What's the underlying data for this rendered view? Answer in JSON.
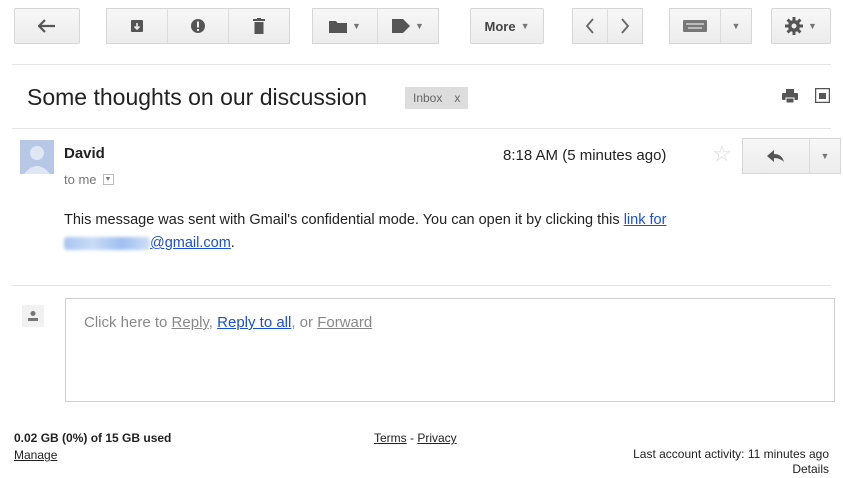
{
  "toolbar": {
    "more_label": "More",
    "icons": [
      "back-arrow-icon",
      "archive-icon",
      "spam-icon",
      "delete-icon",
      "folder-icon",
      "label-icon",
      "prev-icon",
      "next-icon",
      "keyboard-icon",
      "gear-icon"
    ]
  },
  "email": {
    "subject": "Some thoughts on our discussion",
    "label_chip": "Inbox",
    "label_chip_remove": "x",
    "sender": "David",
    "to": "to me",
    "time": "8:18 AM (5 minutes ago)",
    "body_text": "This message was sent with Gmail's confidential mode. You can open it by clicking this ",
    "link_part1": "link for",
    "link_email_domain": "@gmail.com",
    "body_end": "."
  },
  "reply": {
    "prefix": "Click here to ",
    "reply_label": "Reply",
    "sep1": ", ",
    "reply_all_label": "Reply to all",
    "sep2": ", or ",
    "forward_label": "Forward"
  },
  "footer": {
    "storage": "0.02 GB (0%) of 15 GB used",
    "manage": "Manage",
    "terms": "Terms",
    "dash": " - ",
    "privacy": "Privacy",
    "last_activity": "Last account activity: 11 minutes ago",
    "details": "Details"
  }
}
